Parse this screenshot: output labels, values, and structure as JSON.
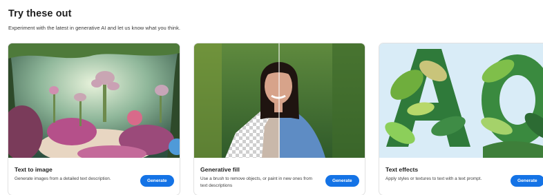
{
  "section": {
    "title": "Try these out",
    "subtitle": "Experiment with the latest in generative AI and let us know what you think."
  },
  "cards": [
    {
      "title": "Text to image",
      "description": "Generate images from a detailed text description.",
      "button": "Generate",
      "image": "fantasy-garden-illustration"
    },
    {
      "title": "Generative fill",
      "description": "Use a brush to remove objects, or paint in new ones from text descriptions",
      "button": "Generate",
      "image": "portrait-with-transparent-fill"
    },
    {
      "title": "Text effects",
      "description": "Apply styles or textures to text with a text prompt.",
      "button": "Generate",
      "image": "leafy-letters-AO"
    }
  ],
  "colors": {
    "accent": "#1473e6",
    "card_border": "#e1e1e1"
  }
}
